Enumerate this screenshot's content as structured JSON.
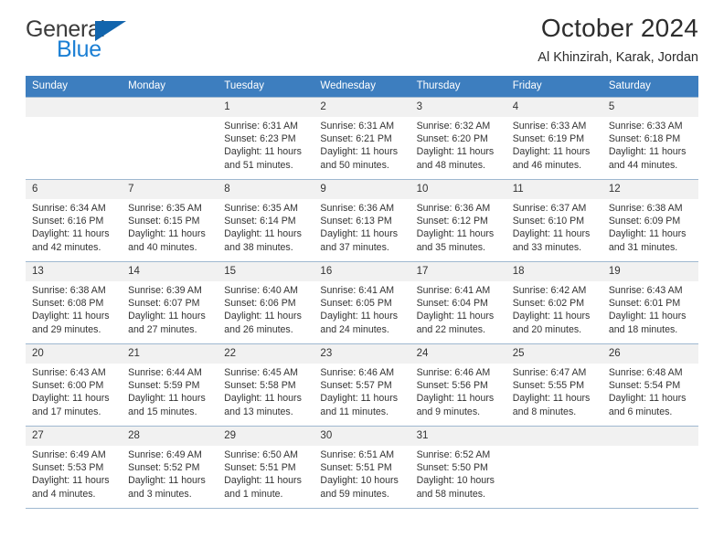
{
  "brand": {
    "name_part1": "General",
    "name_part2": "Blue",
    "accent_color": "#1b7fd4",
    "triangle_color": "#1265ad"
  },
  "header": {
    "title": "October 2024",
    "subtitle": "Al Khinzirah, Karak, Jordan"
  },
  "calendar": {
    "header_bg": "#3d7ebf",
    "daynum_bg": "#f1f1f1",
    "weekdays": [
      "Sunday",
      "Monday",
      "Tuesday",
      "Wednesday",
      "Thursday",
      "Friday",
      "Saturday"
    ],
    "labels": {
      "sunrise": "Sunrise:",
      "sunset": "Sunset:",
      "daylight": "Daylight:"
    },
    "weeks": [
      [
        {
          "day": "",
          "empty": true
        },
        {
          "day": "",
          "empty": true
        },
        {
          "day": "1",
          "sunrise": "Sunrise: 6:31 AM",
          "sunset": "Sunset: 6:23 PM",
          "daylight": "Daylight: 11 hours and 51 minutes."
        },
        {
          "day": "2",
          "sunrise": "Sunrise: 6:31 AM",
          "sunset": "Sunset: 6:21 PM",
          "daylight": "Daylight: 11 hours and 50 minutes."
        },
        {
          "day": "3",
          "sunrise": "Sunrise: 6:32 AM",
          "sunset": "Sunset: 6:20 PM",
          "daylight": "Daylight: 11 hours and 48 minutes."
        },
        {
          "day": "4",
          "sunrise": "Sunrise: 6:33 AM",
          "sunset": "Sunset: 6:19 PM",
          "daylight": "Daylight: 11 hours and 46 minutes."
        },
        {
          "day": "5",
          "sunrise": "Sunrise: 6:33 AM",
          "sunset": "Sunset: 6:18 PM",
          "daylight": "Daylight: 11 hours and 44 minutes."
        }
      ],
      [
        {
          "day": "6",
          "sunrise": "Sunrise: 6:34 AM",
          "sunset": "Sunset: 6:16 PM",
          "daylight": "Daylight: 11 hours and 42 minutes."
        },
        {
          "day": "7",
          "sunrise": "Sunrise: 6:35 AM",
          "sunset": "Sunset: 6:15 PM",
          "daylight": "Daylight: 11 hours and 40 minutes."
        },
        {
          "day": "8",
          "sunrise": "Sunrise: 6:35 AM",
          "sunset": "Sunset: 6:14 PM",
          "daylight": "Daylight: 11 hours and 38 minutes."
        },
        {
          "day": "9",
          "sunrise": "Sunrise: 6:36 AM",
          "sunset": "Sunset: 6:13 PM",
          "daylight": "Daylight: 11 hours and 37 minutes."
        },
        {
          "day": "10",
          "sunrise": "Sunrise: 6:36 AM",
          "sunset": "Sunset: 6:12 PM",
          "daylight": "Daylight: 11 hours and 35 minutes."
        },
        {
          "day": "11",
          "sunrise": "Sunrise: 6:37 AM",
          "sunset": "Sunset: 6:10 PM",
          "daylight": "Daylight: 11 hours and 33 minutes."
        },
        {
          "day": "12",
          "sunrise": "Sunrise: 6:38 AM",
          "sunset": "Sunset: 6:09 PM",
          "daylight": "Daylight: 11 hours and 31 minutes."
        }
      ],
      [
        {
          "day": "13",
          "sunrise": "Sunrise: 6:38 AM",
          "sunset": "Sunset: 6:08 PM",
          "daylight": "Daylight: 11 hours and 29 minutes."
        },
        {
          "day": "14",
          "sunrise": "Sunrise: 6:39 AM",
          "sunset": "Sunset: 6:07 PM",
          "daylight": "Daylight: 11 hours and 27 minutes."
        },
        {
          "day": "15",
          "sunrise": "Sunrise: 6:40 AM",
          "sunset": "Sunset: 6:06 PM",
          "daylight": "Daylight: 11 hours and 26 minutes."
        },
        {
          "day": "16",
          "sunrise": "Sunrise: 6:41 AM",
          "sunset": "Sunset: 6:05 PM",
          "daylight": "Daylight: 11 hours and 24 minutes."
        },
        {
          "day": "17",
          "sunrise": "Sunrise: 6:41 AM",
          "sunset": "Sunset: 6:04 PM",
          "daylight": "Daylight: 11 hours and 22 minutes."
        },
        {
          "day": "18",
          "sunrise": "Sunrise: 6:42 AM",
          "sunset": "Sunset: 6:02 PM",
          "daylight": "Daylight: 11 hours and 20 minutes."
        },
        {
          "day": "19",
          "sunrise": "Sunrise: 6:43 AM",
          "sunset": "Sunset: 6:01 PM",
          "daylight": "Daylight: 11 hours and 18 minutes."
        }
      ],
      [
        {
          "day": "20",
          "sunrise": "Sunrise: 6:43 AM",
          "sunset": "Sunset: 6:00 PM",
          "daylight": "Daylight: 11 hours and 17 minutes."
        },
        {
          "day": "21",
          "sunrise": "Sunrise: 6:44 AM",
          "sunset": "Sunset: 5:59 PM",
          "daylight": "Daylight: 11 hours and 15 minutes."
        },
        {
          "day": "22",
          "sunrise": "Sunrise: 6:45 AM",
          "sunset": "Sunset: 5:58 PM",
          "daylight": "Daylight: 11 hours and 13 minutes."
        },
        {
          "day": "23",
          "sunrise": "Sunrise: 6:46 AM",
          "sunset": "Sunset: 5:57 PM",
          "daylight": "Daylight: 11 hours and 11 minutes."
        },
        {
          "day": "24",
          "sunrise": "Sunrise: 6:46 AM",
          "sunset": "Sunset: 5:56 PM",
          "daylight": "Daylight: 11 hours and 9 minutes."
        },
        {
          "day": "25",
          "sunrise": "Sunrise: 6:47 AM",
          "sunset": "Sunset: 5:55 PM",
          "daylight": "Daylight: 11 hours and 8 minutes."
        },
        {
          "day": "26",
          "sunrise": "Sunrise: 6:48 AM",
          "sunset": "Sunset: 5:54 PM",
          "daylight": "Daylight: 11 hours and 6 minutes."
        }
      ],
      [
        {
          "day": "27",
          "sunrise": "Sunrise: 6:49 AM",
          "sunset": "Sunset: 5:53 PM",
          "daylight": "Daylight: 11 hours and 4 minutes."
        },
        {
          "day": "28",
          "sunrise": "Sunrise: 6:49 AM",
          "sunset": "Sunset: 5:52 PM",
          "daylight": "Daylight: 11 hours and 3 minutes."
        },
        {
          "day": "29",
          "sunrise": "Sunrise: 6:50 AM",
          "sunset": "Sunset: 5:51 PM",
          "daylight": "Daylight: 11 hours and 1 minute."
        },
        {
          "day": "30",
          "sunrise": "Sunrise: 6:51 AM",
          "sunset": "Sunset: 5:51 PM",
          "daylight": "Daylight: 10 hours and 59 minutes."
        },
        {
          "day": "31",
          "sunrise": "Sunrise: 6:52 AM",
          "sunset": "Sunset: 5:50 PM",
          "daylight": "Daylight: 10 hours and 58 minutes."
        },
        {
          "day": "",
          "empty": true
        },
        {
          "day": "",
          "empty": true
        }
      ]
    ]
  }
}
